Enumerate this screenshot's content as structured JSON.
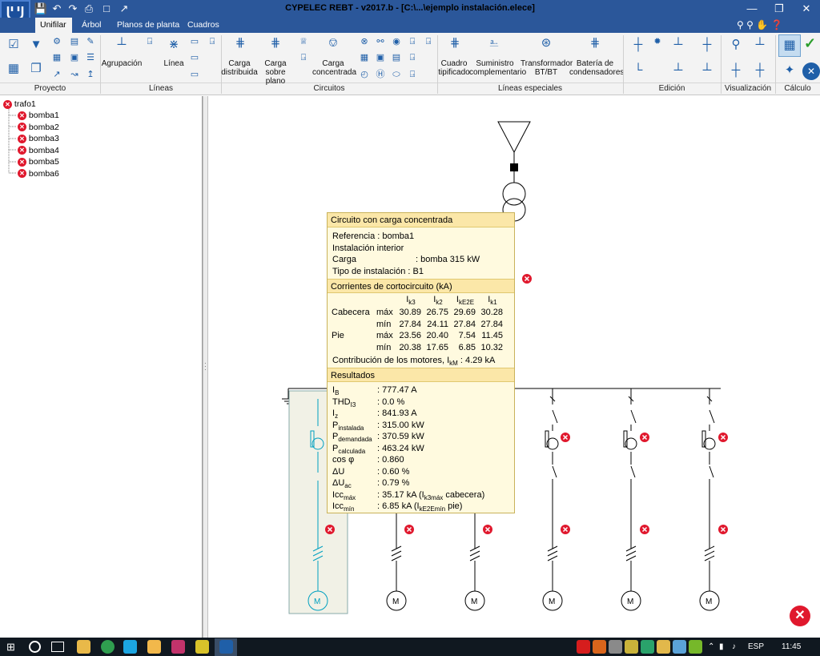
{
  "app": {
    "title": "CYPELEC REBT - v2017.b - [C:\\...\\ejemplo instalación.elece]"
  },
  "tabs": [
    "Unifilar",
    "Árbol",
    "Planos de planta",
    "Cuadros"
  ],
  "ribbon": {
    "groups": [
      "Proyecto",
      "Líneas",
      "Circuitos",
      "Líneas especiales",
      "Edición",
      "Visualización",
      "Cálculo"
    ],
    "buttons": {
      "agrupacion": "Agrupación",
      "linea": "Línea",
      "carga_distribuida": [
        "Carga",
        "distribuida"
      ],
      "carga_sobre_plano": [
        "Carga",
        "sobre plano"
      ],
      "carga_concentrada": [
        "Carga",
        "concentrada"
      ],
      "cuadro_tipificado": [
        "Cuadro",
        "tipificado"
      ],
      "suministro": [
        "Suministro",
        "complementario"
      ],
      "transformador": [
        "Transformador",
        "BT/BT"
      ],
      "bateria": [
        "Batería de",
        "condensadores"
      ]
    }
  },
  "tree": {
    "root": "trafo1",
    "children": [
      "bomba1",
      "bomba2",
      "bomba3",
      "bomba4",
      "bomba5",
      "bomba6"
    ]
  },
  "tooltip": {
    "title": "Circuito con carga concentrada",
    "referencia": "Referencia : bomba1",
    "instalacion": "Instalación interior",
    "carga_label": "Carga",
    "carga_value": ": bomba 315 kW",
    "tipo_label": "Tipo de instalación",
    "tipo_value": ": B1",
    "corrientes_title": "Corrientes de cortocircuito (kA)",
    "cc_headers": [
      "I",
      "I",
      "I",
      "I"
    ],
    "cc_subs": [
      "k3",
      "k2",
      "kE2E",
      "k1"
    ],
    "cc_rows": [
      {
        "pos": "Cabecera",
        "mm": "máx",
        "vals": [
          "30.89",
          "26.75",
          "29.69",
          "30.28"
        ]
      },
      {
        "pos": "",
        "mm": "mín",
        "vals": [
          "27.84",
          "24.11",
          "27.84",
          "27.84"
        ]
      },
      {
        "pos": "Pie",
        "mm": "máx",
        "vals": [
          "23.56",
          "20.40",
          "7.54",
          "11.45"
        ]
      },
      {
        "pos": "",
        "mm": "mín",
        "vals": [
          "20.38",
          "17.65",
          "6.85",
          "10.32"
        ]
      }
    ],
    "motores_label": "Contribución de los motores, I",
    "motores_sub": "kM",
    "motores_value": ": 4.29 kA",
    "resultados_title": "Resultados",
    "results": [
      {
        "sym": "I",
        "sub": "B",
        "val": ": 777.47 A"
      },
      {
        "sym": "THD",
        "sub": "I3",
        "val": ": 0.0 %"
      },
      {
        "sym": "I",
        "sub": "z",
        "val": ": 841.93 A"
      },
      {
        "sym": "P",
        "sub": "instalada",
        "val": ": 315.00 kW"
      },
      {
        "sym": "P",
        "sub": "demandada",
        "val": ": 370.59 kW"
      },
      {
        "sym": "P",
        "sub": "calculada",
        "val": ": 463.24 kW"
      },
      {
        "sym": "cos φ",
        "sub": "",
        "val": ": 0.860"
      },
      {
        "sym": "ΔU",
        "sub": "",
        "val": ": 0.60 %"
      },
      {
        "sym": "ΔU",
        "sub": "ac",
        "val": ": 0.79 %"
      },
      {
        "sym": "Icc",
        "sub": "máx",
        "val": ": 35.17 kA (I",
        "val_sub": "k3máx",
        "val_tail": " cabecera)"
      },
      {
        "sym": "Icc",
        "sub": "mín",
        "val": ": 6.85 kA (I",
        "val_sub": "kE2Emín",
        "val_tail": " pie)"
      }
    ]
  },
  "motor_label": "M",
  "taskbar": {
    "lang": "ESP",
    "time": "11:45"
  },
  "colors": {
    "title": "#2b579a",
    "error": "#e0182d",
    "tooltip_bg": "#fffadf",
    "tooltip_head": "#fbe7a8",
    "selected_circuit": "#00a0c0"
  }
}
